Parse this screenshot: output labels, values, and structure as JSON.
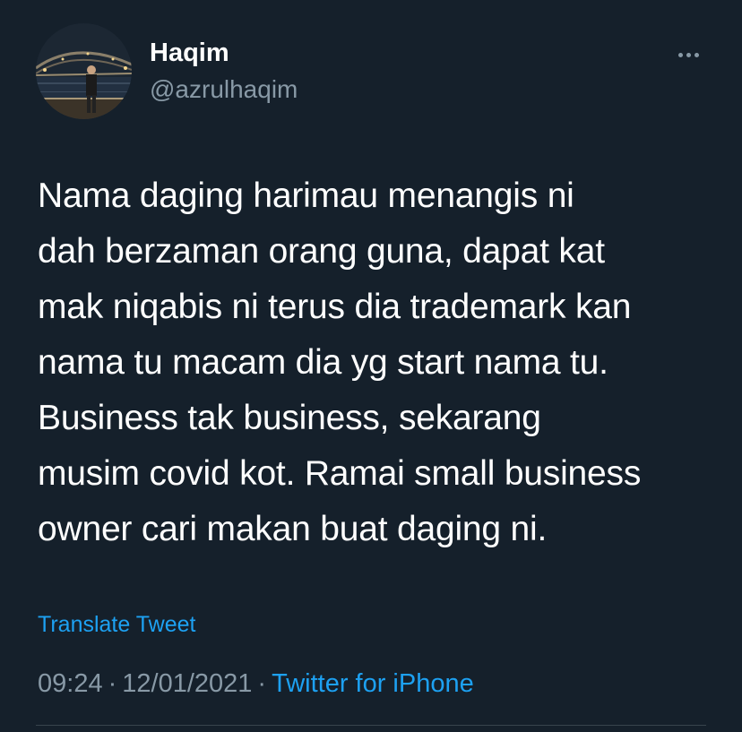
{
  "author": {
    "display_name": "Haqim",
    "handle": "@azrulhaqim"
  },
  "tweet": {
    "lines": [
      "Nama daging harimau menangis ni",
      "dah berzaman orang guna, dapat kat",
      "mak niqabis ni terus dia trademark kan",
      "nama tu macam dia yg start nama tu.",
      "Business tak business, sekarang",
      "musim covid kot. Ramai small business",
      "owner cari makan buat daging ni."
    ]
  },
  "translate_label": "Translate Tweet",
  "meta": {
    "time": "09:24",
    "separator": "·",
    "date": "12/01/2021",
    "source": "Twitter for iPhone"
  },
  "icons": {
    "more": "more-horizontal-icon"
  },
  "colors": {
    "background": "#15202b",
    "accent": "#1da1f2",
    "secondary_text": "#8899a6",
    "primary_text": "#ffffff"
  }
}
